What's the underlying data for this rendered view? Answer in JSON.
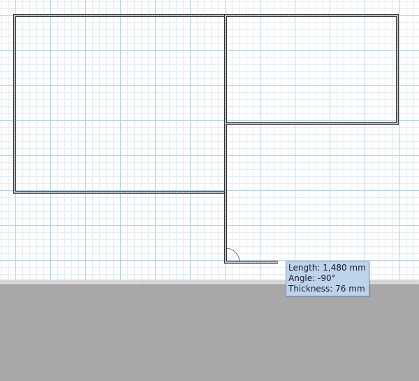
{
  "tooltip": {
    "length": "Length: 1,480 mm",
    "angle": "Angle: -90°",
    "thickness": "Thickness: 76 mm"
  },
  "colors": {
    "wall_stroke": "#333333",
    "wall_fill": "#ffffff",
    "grid_major": "#b9d3e6",
    "grid_minor": "#e3eef6",
    "tooltip_bg": "#bcd3ec",
    "outside_bg": "#a8a8a8"
  }
}
